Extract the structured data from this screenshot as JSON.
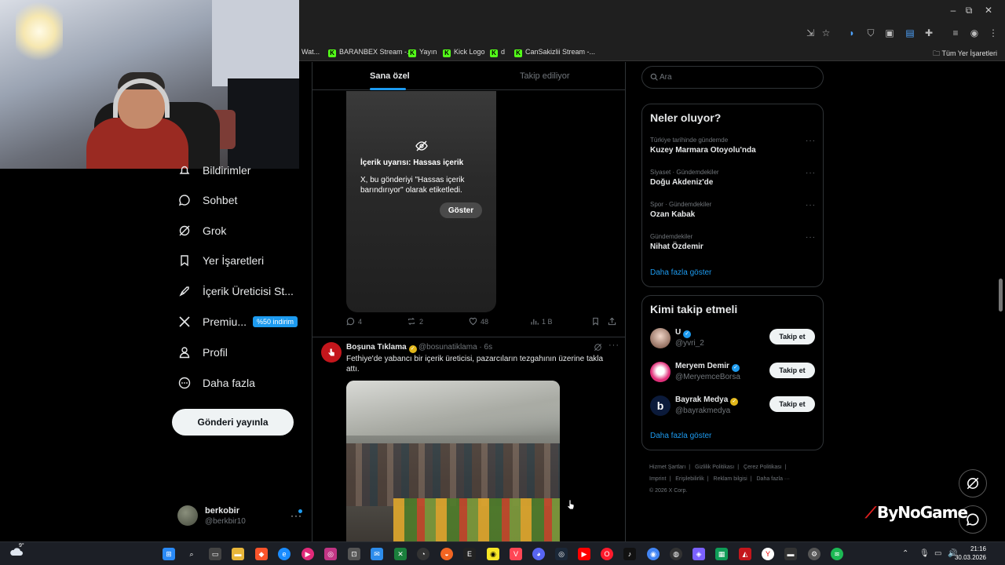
{
  "browser": {
    "bookmarks": [
      {
        "label": "Wat..."
      },
      {
        "label": "BARANBEX Stream -..."
      },
      {
        "label": "Yayın"
      },
      {
        "label": "Kick Logo"
      },
      {
        "label": "d"
      },
      {
        "label": "CanSakizlii Stream -..."
      }
    ],
    "bookmarks_folder": "Tüm Yer İşaretleri"
  },
  "sidebar": {
    "items": [
      {
        "label": "Bildirimler"
      },
      {
        "label": "Sohbet"
      },
      {
        "label": "Grok"
      },
      {
        "label": "Yer İşaretleri"
      },
      {
        "label": "İçerik Üreticisi St..."
      },
      {
        "label": "Premiu...",
        "badge": "%50 indirim"
      },
      {
        "label": "Profil"
      },
      {
        "label": "Daha fazla"
      }
    ],
    "post_button": "Gönderi yayınla",
    "account": {
      "name": "berkobir",
      "handle": "@berkbir10",
      "more": "···"
    }
  },
  "timeline": {
    "tabs": [
      {
        "label": "Sana özel",
        "active": true
      },
      {
        "label": "Takip ediliyor",
        "active": false
      }
    ],
    "sensitive": {
      "title": "İçerik uyarısı: Hassas içerik",
      "description": "X, bu gönderiyi \"Hassas içerik barındırıyor\" olarak etiketledi.",
      "show_button": "Göster"
    },
    "actions": {
      "replies": "4",
      "reposts": "2",
      "likes": "48",
      "views": "1 B"
    },
    "tweet2": {
      "name": "Boşuna Tıklama",
      "handle": "@bosunatiklama · 6s",
      "text": "Fethiye'de yabancı bir içerik üreticisi, pazarcıların tezgahının üzerine takla attı."
    }
  },
  "right": {
    "search_placeholder": "Ara",
    "trends_title": "Neler oluyor?",
    "trends": [
      {
        "meta": "Türkiye tarihinde gündemde",
        "name": "Kuzey Marmara Otoyolu'nda"
      },
      {
        "meta": "Siyaset · Gündemdekiler",
        "name": "Doğu Akdeniz'de"
      },
      {
        "meta": "Spor · Gündemdekiler",
        "name": "Ozan Kabak"
      },
      {
        "meta": "Gündemdekiler",
        "name": "Nihat Özdemir"
      }
    ],
    "show_more": "Daha fazla göster",
    "who_title": "Kimi takip etmeli",
    "who": [
      {
        "name": "U",
        "handle": "@yvri_2",
        "button": "Takip et"
      },
      {
        "name": "Meryem Demir",
        "handle": "@MeryemceBorsa",
        "button": "Takip et"
      },
      {
        "name": "Bayrak Medya",
        "handle": "@bayrakmedya",
        "button": "Takip et"
      }
    ],
    "who_more": "Daha fazla göster",
    "footer": [
      "Hizmet Şartları",
      "|",
      "Gizlilik Politikası",
      "|",
      "Çerez Politikası",
      "|",
      "Imprint",
      "|",
      "Erişilebilirlik",
      "|",
      "Reklam bilgisi",
      "|",
      "Daha fazla ···",
      "© 2026 X Corp."
    ]
  },
  "watermark": "ByNoGame",
  "taskbar": {
    "weather_temp": "9°",
    "time": "21:16",
    "date": "30.03.2026"
  },
  "colors": {
    "accent": "#1d9bf0",
    "background": "#000000",
    "border": "#2f3336",
    "muted": "#71767b"
  }
}
